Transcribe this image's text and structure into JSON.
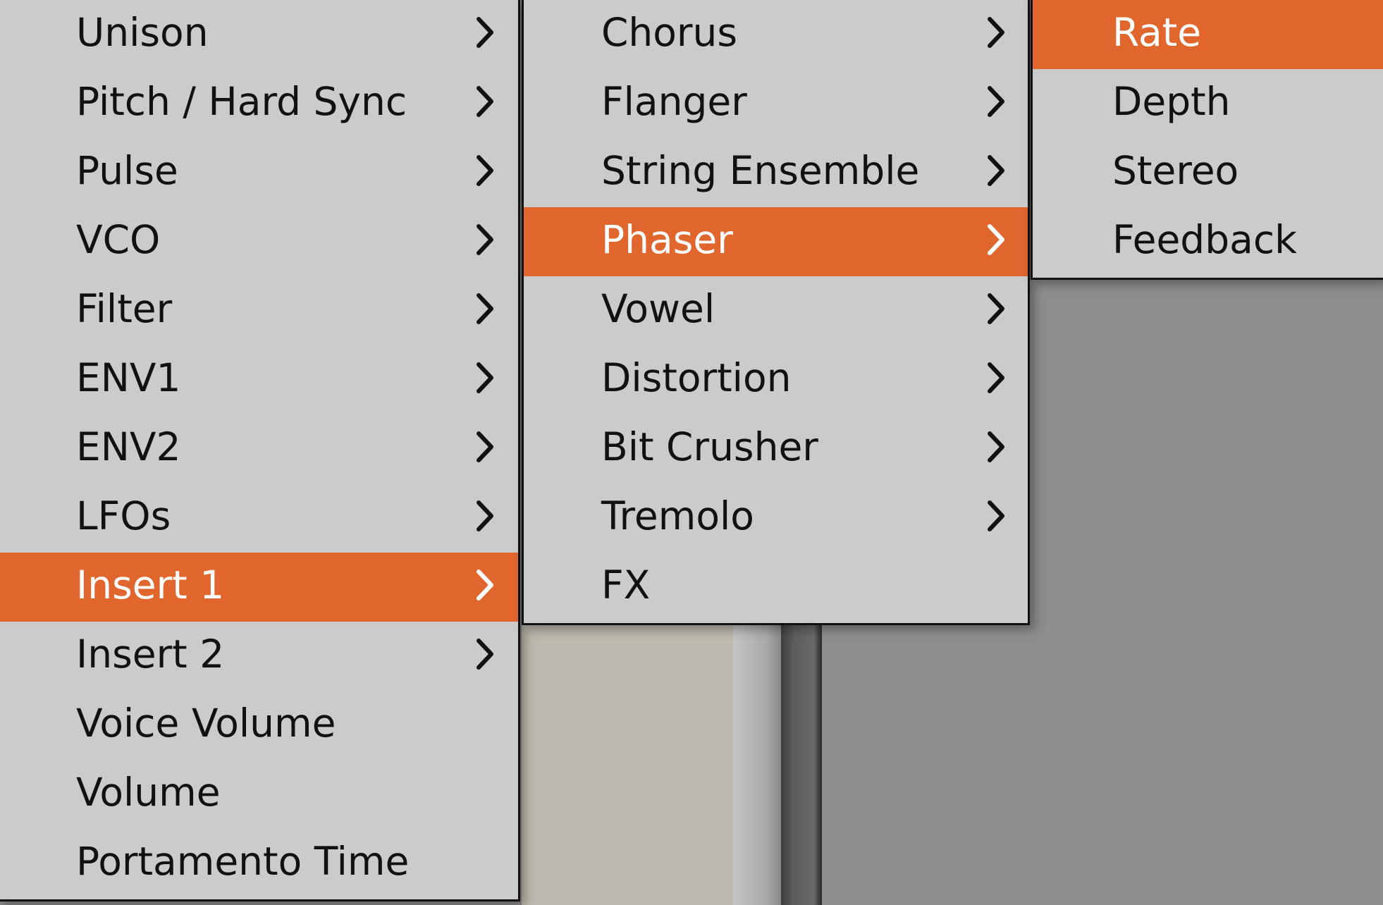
{
  "colors": {
    "highlight": "#e0662e",
    "menu_bg": "#cbcbcb",
    "text": "#111111",
    "highlight_text": "#ffffff"
  },
  "menu1": {
    "items": [
      {
        "label": "Unison",
        "submenu": true
      },
      {
        "label": "Pitch / Hard Sync",
        "submenu": true
      },
      {
        "label": "Pulse",
        "submenu": true
      },
      {
        "label": "VCO",
        "submenu": true
      },
      {
        "label": "Filter",
        "submenu": true
      },
      {
        "label": "ENV1",
        "submenu": true
      },
      {
        "label": "ENV2",
        "submenu": true
      },
      {
        "label": "LFOs",
        "submenu": true
      },
      {
        "label": "Insert 1",
        "submenu": true,
        "selected": true
      },
      {
        "label": "Insert 2",
        "submenu": true
      },
      {
        "label": "Voice Volume",
        "submenu": false
      },
      {
        "label": "Volume",
        "submenu": false
      },
      {
        "label": "Portamento Time",
        "submenu": false
      }
    ]
  },
  "menu2": {
    "items": [
      {
        "label": "Chorus",
        "submenu": true
      },
      {
        "label": "Flanger",
        "submenu": true
      },
      {
        "label": "String Ensemble",
        "submenu": true
      },
      {
        "label": "Phaser",
        "submenu": true,
        "selected": true
      },
      {
        "label": "Vowel",
        "submenu": true
      },
      {
        "label": "Distortion",
        "submenu": true
      },
      {
        "label": "Bit Crusher",
        "submenu": true
      },
      {
        "label": "Tremolo",
        "submenu": true
      },
      {
        "label": "FX",
        "submenu": false
      }
    ]
  },
  "menu3": {
    "items": [
      {
        "label": "Rate",
        "selected": true
      },
      {
        "label": "Depth"
      },
      {
        "label": "Stereo"
      },
      {
        "label": "Feedback"
      }
    ]
  }
}
